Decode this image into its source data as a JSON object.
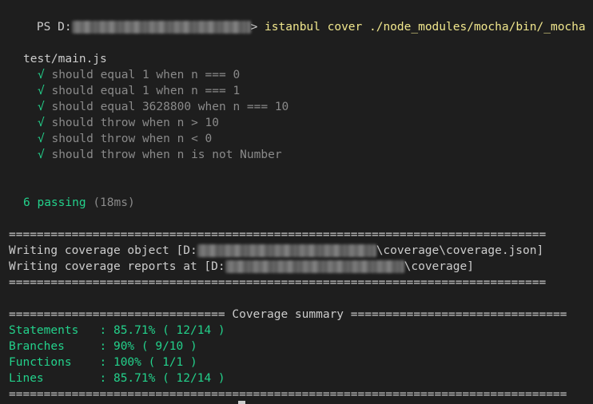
{
  "prompt": {
    "prefix": "PS D:",
    "suffix": "> ",
    "command": "istanbul cover ./node_modules/mocha/bin/_mocha"
  },
  "suite": {
    "file": "test/main.js",
    "check_glyph": "√",
    "tests": [
      "should equal 1 when n === 0",
      "should equal 1 when n === 1",
      "should equal 3628800 when n === 10",
      "should throw when n > 10",
      "should throw when n < 0",
      "should throw when n is not Number"
    ],
    "passing": "6 passing",
    "duration": "(18ms)"
  },
  "writing": {
    "separator": "=============================================================================",
    "object_prefix": "Writing coverage object [D:",
    "object_suffix": "\\coverage\\coverage.json]",
    "reports_prefix": "Writing coverage reports at [D:",
    "reports_suffix": "\\coverage]"
  },
  "summary": {
    "header_left": "=============================== ",
    "header_title": "Coverage summary",
    "header_right": " ===============================",
    "rows": [
      {
        "label": "Statements   ",
        "sep": ": ",
        "value": "85.71% ( 12/14 )"
      },
      {
        "label": "Branches     ",
        "sep": ": ",
        "value": "90% ( 9/10 )"
      },
      {
        "label": "Functions    ",
        "sep": ": ",
        "value": "100% ( 1/1 )"
      },
      {
        "label": "Lines        ",
        "sep": ": ",
        "value": "85.71% ( 12/14 )"
      }
    ],
    "footer": "================================================================================"
  },
  "colors": {
    "background": "#1e1e1e",
    "text": "#cccccc",
    "command": "#f0e68c",
    "success": "#23d18b",
    "dim": "#8a8a8a"
  }
}
